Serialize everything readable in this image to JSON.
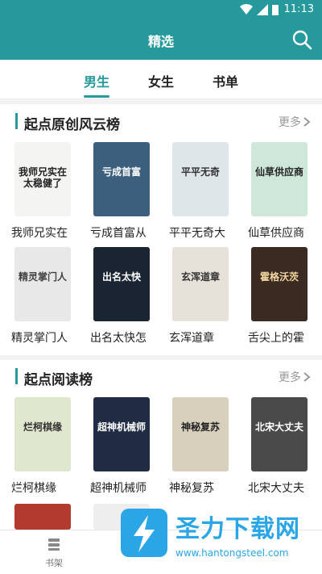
{
  "status": {
    "time": "11:13"
  },
  "header": {
    "title": "精选",
    "search_icon": "search-icon"
  },
  "tabs": [
    {
      "label": "男生",
      "active": true
    },
    {
      "label": "女生",
      "active": false
    },
    {
      "label": "书单",
      "active": false
    }
  ],
  "sections": [
    {
      "title": "起点原创风云榜",
      "more": "更多",
      "books": [
        {
          "name": "我师兄实在",
          "cover_text": "我师兄实在太稳健了",
          "bg": "#f4f4f2",
          "fg": "#222"
        },
        {
          "name": "亏成首富从",
          "cover_text": "亏成首富",
          "bg": "#3d5f7e",
          "fg": "#ffffff"
        },
        {
          "name": "平平无奇大",
          "cover_text": "平平无奇",
          "bg": "#dfe6ea",
          "fg": "#333"
        },
        {
          "name": "仙草供应商",
          "cover_text": "仙草供应商",
          "bg": "#cfe7d8",
          "fg": "#222"
        },
        {
          "name": "精灵掌门人",
          "cover_text": "精灵掌门人",
          "bg": "#e8e8e8",
          "fg": "#444"
        },
        {
          "name": "出名太快怎",
          "cover_text": "出名太快",
          "bg": "#1b2433",
          "fg": "#ffffff"
        },
        {
          "name": "玄浑道章",
          "cover_text": "玄浑道章",
          "bg": "#e6e2da",
          "fg": "#333"
        },
        {
          "name": "舌尖上的霍",
          "cover_text": "霍格沃茨",
          "bg": "#3a2a22",
          "fg": "#f3d7a0"
        }
      ]
    },
    {
      "title": "起点阅读榜",
      "more": "更多",
      "books": [
        {
          "name": "烂柯棋缘",
          "cover_text": "烂柯棋缘",
          "bg": "#dfe7cf",
          "fg": "#333"
        },
        {
          "name": "超神机械师",
          "cover_text": "超神机械师",
          "bg": "#202b44",
          "fg": "#ffffff"
        },
        {
          "name": "神秘复苏",
          "cover_text": "神秘复苏",
          "bg": "#d8cfbd",
          "fg": "#222"
        },
        {
          "name": "北宋大丈夫",
          "cover_text": "北宋大丈夫",
          "bg": "#4a4a4a",
          "fg": "#ffffff"
        }
      ]
    }
  ],
  "bottom_nav": {
    "shelf_label": "书架"
  },
  "watermark": {
    "title": "圣力下载网",
    "url": "www.hantongsteel.com"
  },
  "colors": {
    "accent": "#26999d",
    "watermark": "#2aa5e6"
  }
}
